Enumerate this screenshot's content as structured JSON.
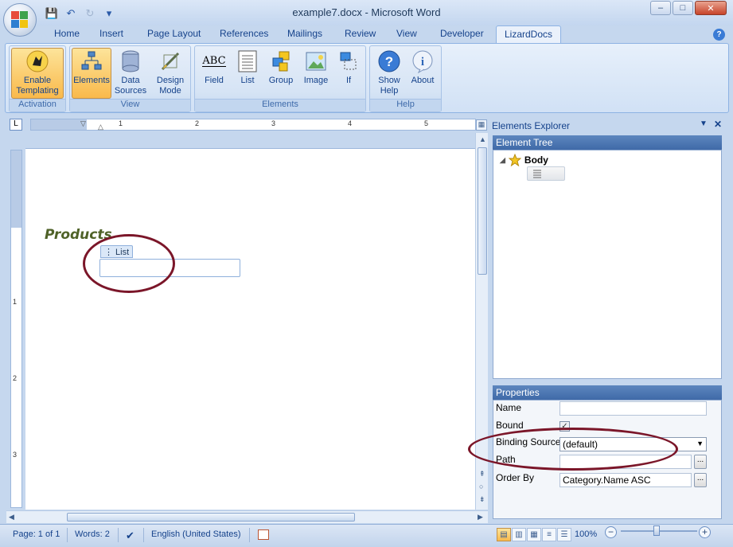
{
  "window": {
    "title": "example7.docx - Microsoft Word",
    "controls": {
      "minimize": "–",
      "maximize": "□",
      "close": "✕"
    }
  },
  "quick_access": {
    "save": "💾",
    "undo": "↶",
    "redo": "↻",
    "customize": "▾"
  },
  "tabs": [
    "Home",
    "Insert",
    "Page Layout",
    "References",
    "Mailings",
    "Review",
    "View",
    "Developer",
    "LizardDocs"
  ],
  "active_tab": "LizardDocs",
  "ribbon": {
    "groups": [
      {
        "label": "Activation",
        "buttons": [
          {
            "label": "Enable\nTemplating",
            "icon": "lizard-icon"
          }
        ]
      },
      {
        "label": "View",
        "buttons": [
          {
            "label": "Elements",
            "icon": "elements-icon"
          },
          {
            "label": "Data\nSources",
            "icon": "database-icon"
          },
          {
            "label": "Design\nMode",
            "icon": "design-mode-icon"
          }
        ]
      },
      {
        "label": "Elements",
        "buttons": [
          {
            "label": "Field",
            "icon": "field-icon"
          },
          {
            "label": "List",
            "icon": "list-icon"
          },
          {
            "label": "Group",
            "icon": "group-icon"
          },
          {
            "label": "Image",
            "icon": "image-icon"
          },
          {
            "label": "If",
            "icon": "if-icon"
          }
        ]
      },
      {
        "label": "Help",
        "buttons": [
          {
            "label": "Show\nHelp",
            "icon": "help-icon"
          },
          {
            "label": "About",
            "icon": "about-icon"
          }
        ]
      }
    ],
    "field_icon_text": "ABC"
  },
  "ruler": {
    "h_numbers": [
      "1",
      "2",
      "3",
      "4",
      "5"
    ],
    "v_numbers": [
      "1",
      "2",
      "3"
    ],
    "tab_button": "L"
  },
  "document": {
    "heading": "Products",
    "list_tag": "⋮ List"
  },
  "elements_explorer": {
    "title": "Elements Explorer",
    "tree_title": "Element Tree",
    "root_node": "Body",
    "properties_title": "Properties",
    "properties": {
      "name_label": "Name",
      "name_value": "",
      "bound_label": "Bound",
      "bound_checked": true,
      "binding_source_label": "Binding Source",
      "binding_source_value": "(default)",
      "path_label": "Path",
      "path_value": "",
      "order_by_label": "Order By",
      "order_by_value": "Category.Name ASC",
      "browse": "..."
    }
  },
  "status": {
    "page": "Page: 1 of 1",
    "words": "Words: 2",
    "language": "English (United States)",
    "zoom": "100%",
    "zoom_minus": "−",
    "zoom_plus": "+"
  },
  "colors": {
    "annotation": "#7b1629",
    "heading": "#4f6228",
    "panel_header": "#3f6aa8"
  }
}
